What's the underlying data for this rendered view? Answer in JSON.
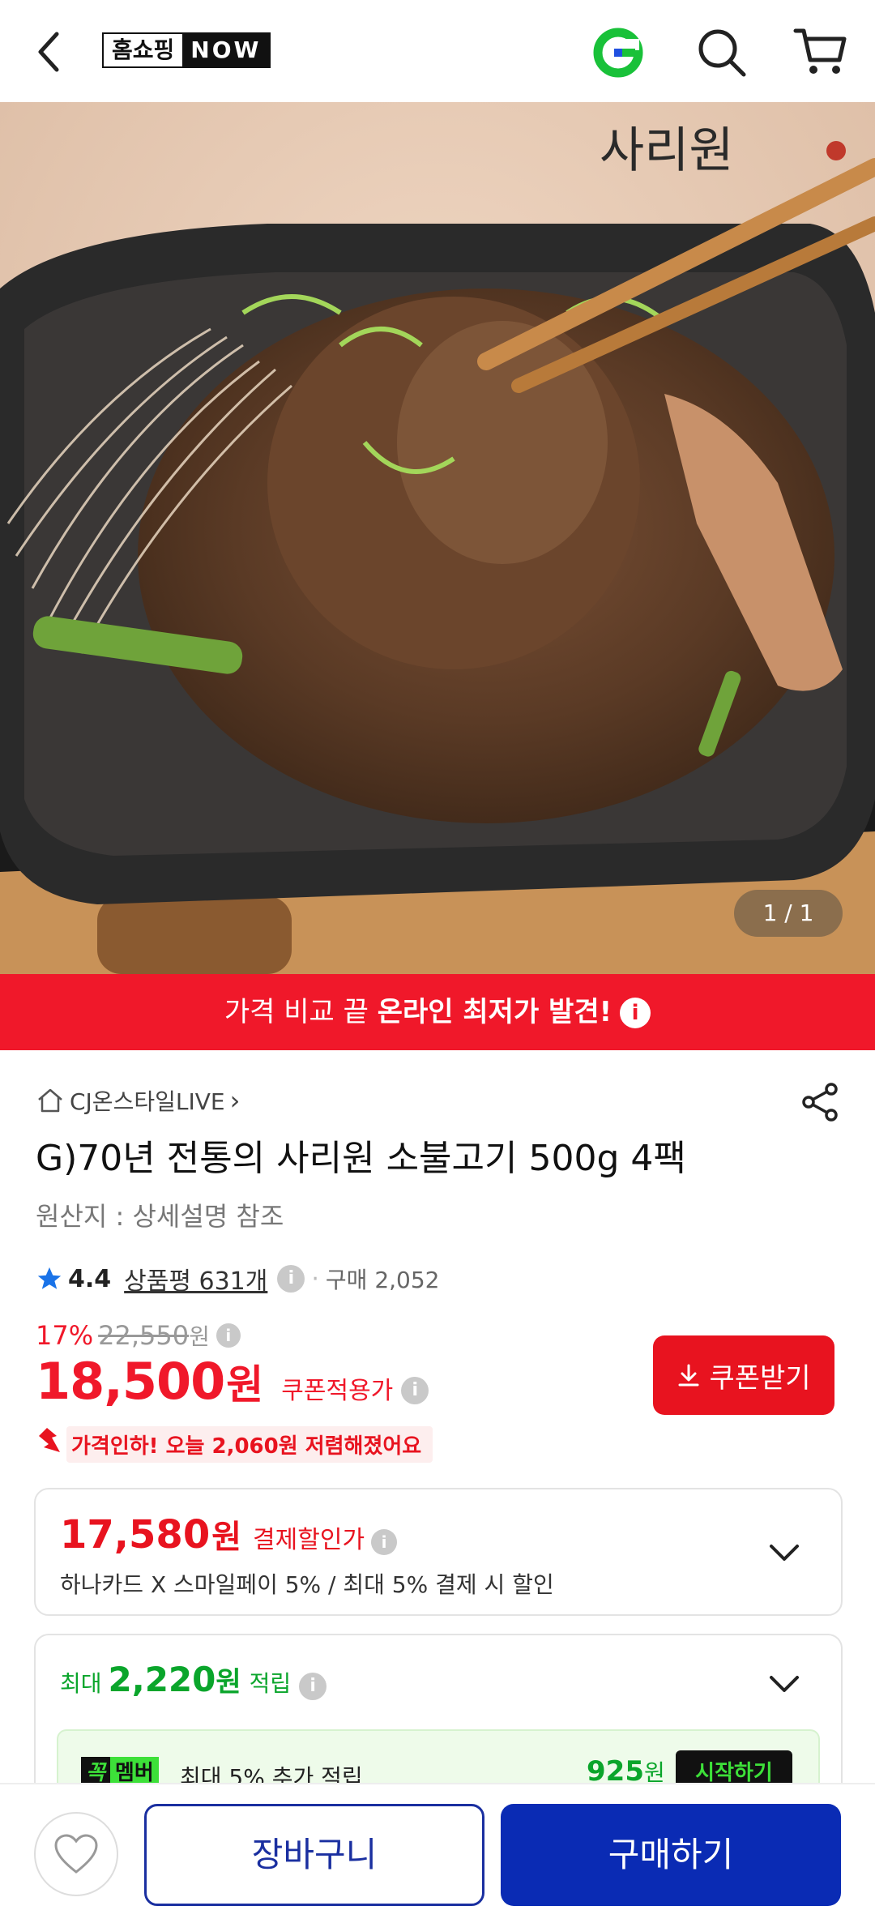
{
  "header": {
    "logo_part1": "홈쇼핑",
    "logo_part2": "NOW",
    "icons": [
      "back-arrow-icon",
      "g-logo-icon",
      "search-icon",
      "cart-icon"
    ]
  },
  "hero": {
    "brand_text": "사리원",
    "counter": "1 / 1"
  },
  "banner": {
    "text_normal": "가격 비교 끝 ",
    "text_bold": "온라인 최저가 발견!",
    "info": "i"
  },
  "product": {
    "seller": "CJ온스타일LIVE",
    "seller_chevron": "›",
    "title": "G)70년 전통의 사리원 소불고기 500g 4팩",
    "origin": "원산지 : 상세설명 참조",
    "rating": "4.4",
    "reviews": "상품평 631개",
    "purchases": "구매 2,052",
    "discount_pct": "17%",
    "original_price": "22,550",
    "original_unit": "원",
    "price": "18,500",
    "price_unit": "원",
    "price_label": "쿠폰적용가",
    "coupon_button": "쿠폰받기",
    "price_down": "가격인하! 오늘 2,060원 저렴해졌어요"
  },
  "payment_card": {
    "price": "17,580",
    "unit": "원",
    "label": "결제할인가",
    "desc": "하나카드 X 스마일페이 5% / 최대 5% 결제 시 할인"
  },
  "points_card": {
    "prefix": "최대",
    "amount": "2,220",
    "unit": "원",
    "suffix": "적립",
    "member_tag1": "꼭",
    "member_tag2": "멤버",
    "member_text": "최대 5% 추가 적립",
    "member_amount": "925",
    "member_unit": "원",
    "member_button": "시작하기"
  },
  "bottom": {
    "cart_button": "장바구니",
    "buy_button": "구매하기"
  },
  "colors": {
    "accent_red": "#f0182a",
    "accent_blue": "#0a2bb4",
    "accent_green": "#0aa52b",
    "star_blue": "#1a73e8"
  }
}
